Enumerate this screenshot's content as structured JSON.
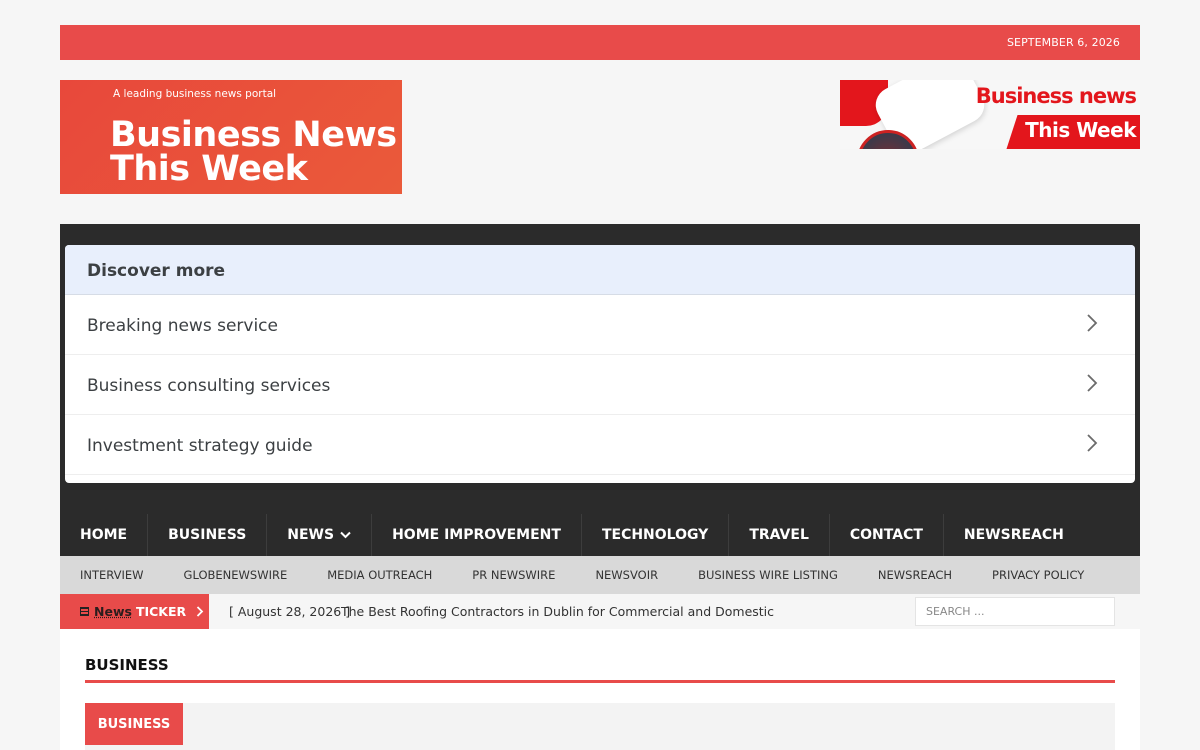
{
  "topbar": {
    "date": "SEPTEMBER 6, 2026"
  },
  "logo": {
    "tagline": "A leading business news portal",
    "name_line1": "Business News",
    "name_line2": "This Week"
  },
  "banner": {
    "line1": "Business news",
    "line2": "This Week"
  },
  "discover": {
    "title": "Discover more",
    "items": [
      {
        "label": "Breaking news service"
      },
      {
        "label": "Business consulting services"
      },
      {
        "label": "Investment strategy guide"
      }
    ]
  },
  "main_nav": {
    "items": [
      {
        "label": "HOME"
      },
      {
        "label": "BUSINESS"
      },
      {
        "label": "NEWS"
      },
      {
        "label": "HOME IMPROVEMENT"
      },
      {
        "label": "TECHNOLOGY"
      },
      {
        "label": "TRAVEL"
      },
      {
        "label": "CONTACT"
      },
      {
        "label": "NEWSREACH"
      }
    ]
  },
  "sub_nav": {
    "items": [
      {
        "label": "INTERVIEW"
      },
      {
        "label": "GLOBENEWSWIRE"
      },
      {
        "label": "MEDIA OUTREACH"
      },
      {
        "label": "PR NEWSWIRE"
      },
      {
        "label": "NEWSVOIR"
      },
      {
        "label": "BUSINESS WIRE LISTING"
      },
      {
        "label": "NEWSREACH"
      },
      {
        "label": "PRIVACY POLICY"
      }
    ]
  },
  "ticker": {
    "label_word": "News",
    "label_rest": "TICKER",
    "date": "[ August 28, 2026 ]",
    "headline": "The Best Roofing Contractors in Dublin for Commercial and Domestic",
    "search_placeholder": "SEARCH ..."
  },
  "section": {
    "title": "BUSINESS",
    "category_button": "BUSINESS"
  },
  "colors": {
    "accent": "#e84b4a",
    "dark_nav": "#2b2b2b",
    "subnav_bg": "#d9d9d9",
    "discover_head": "#e8effc"
  }
}
